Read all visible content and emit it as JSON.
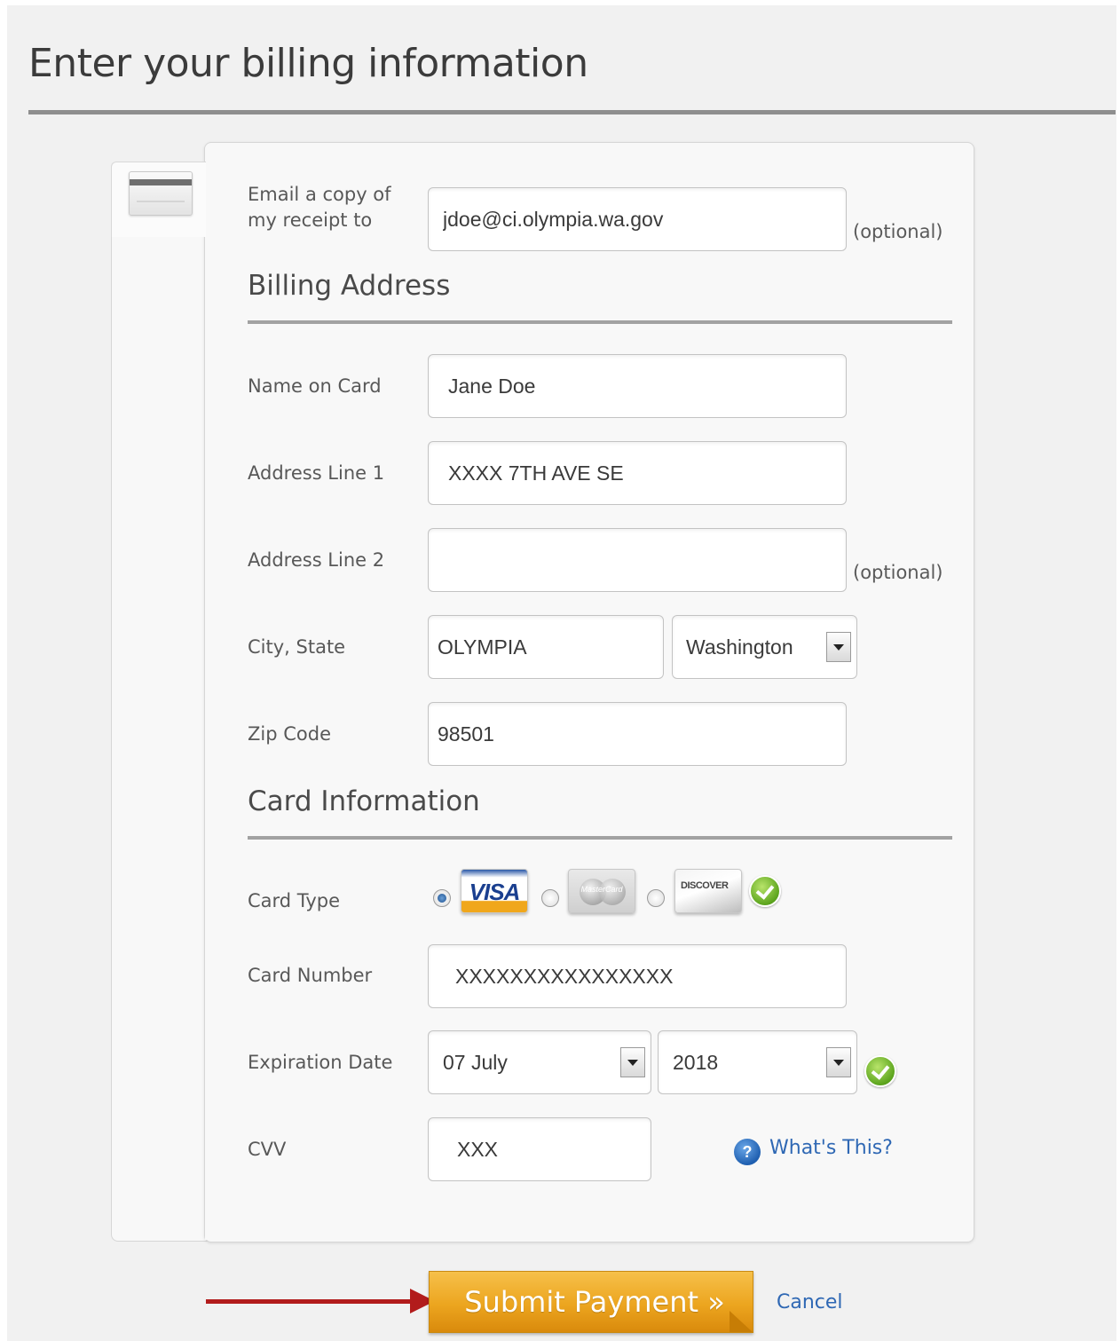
{
  "page": {
    "title": "Enter your billing information"
  },
  "email": {
    "label_line1": "Email a copy of",
    "label_line2": "my receipt to",
    "value": "jdoe@ci.olympia.wa.gov",
    "optional": "(optional)"
  },
  "billing": {
    "section_title": "Billing Address",
    "name": {
      "label": "Name on Card",
      "value": "Jane Doe"
    },
    "address1": {
      "label": "Address Line 1",
      "value": "XXXX 7TH AVE SE"
    },
    "address2": {
      "label": "Address Line 2",
      "value": "",
      "optional": "(optional)"
    },
    "city_state": {
      "label": "City, State",
      "city": "OLYMPIA",
      "state": "Washington"
    },
    "zip": {
      "label": "Zip Code",
      "value": "98501"
    }
  },
  "card": {
    "section_title": "Card Information",
    "type": {
      "label": "Card Type",
      "options": [
        "VISA",
        "MasterCard",
        "DISCOVER"
      ],
      "selected": "VISA"
    },
    "number": {
      "label": "Card Number",
      "value": "XXXXXXXXXXXXXXXX"
    },
    "expiration": {
      "label": "Expiration Date",
      "month": "07 July",
      "year": "2018"
    },
    "cvv": {
      "label": "CVV",
      "value": "XXX",
      "help_text": "What's This?"
    }
  },
  "actions": {
    "submit_label": "Submit Payment »",
    "cancel_label": "Cancel"
  },
  "colors": {
    "accent": "#eca51f",
    "link": "#2f68b4",
    "arrow": "#b21c1c",
    "valid": "#5da51e"
  },
  "icons": [
    "credit-card-icon",
    "check-icon",
    "help-icon",
    "dropdown-arrow-icon",
    "red-arrow-icon"
  ]
}
